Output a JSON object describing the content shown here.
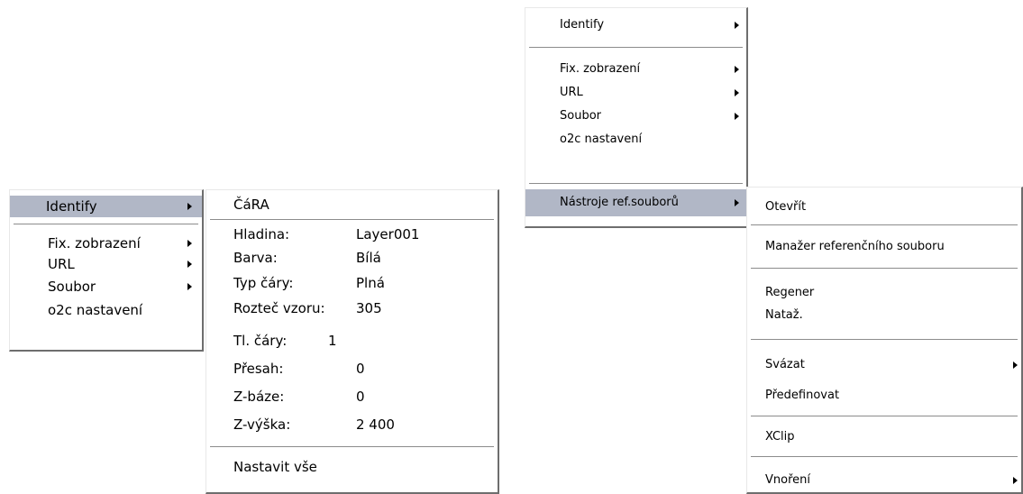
{
  "left_menu": {
    "items": [
      {
        "label": "Identify",
        "has_submenu": true,
        "selected": true
      },
      {
        "label": "Fix. zobrazení",
        "has_submenu": true
      },
      {
        "label": "URL",
        "has_submenu": true
      },
      {
        "label": "Soubor",
        "has_submenu": true
      },
      {
        "label": "o2c nastavení",
        "has_submenu": false
      }
    ]
  },
  "identify_panel": {
    "title": "ČáRA",
    "properties": [
      {
        "key": "Hladina:",
        "value": "Layer001"
      },
      {
        "key": "Barva:",
        "value": "Bílá"
      },
      {
        "key": "Typ čáry:",
        "value": "Plná"
      },
      {
        "key": "Rozteč vzoru:",
        "value": "305"
      },
      {
        "key": "Tl. čáry:",
        "value": "1"
      },
      {
        "key": "Přesah:",
        "value": "0"
      },
      {
        "key": "Z-báze:",
        "value": "0"
      },
      {
        "key": "Z-výška:",
        "value": "2 400"
      }
    ],
    "set_all": "Nastavit vše"
  },
  "right_menu": {
    "items": [
      {
        "label": "Identify",
        "has_submenu": true
      },
      {
        "label": "Fix. zobrazení",
        "has_submenu": true
      },
      {
        "label": "URL",
        "has_submenu": true
      },
      {
        "label": "Soubor",
        "has_submenu": true
      },
      {
        "label": "o2c nastavení",
        "has_submenu": false
      },
      {
        "label": "Nástroje ref.souborů",
        "has_submenu": true,
        "selected": true
      }
    ]
  },
  "ref_tools_submenu": {
    "items": [
      {
        "label": "Otevřít"
      },
      {
        "label": "Manažer referenčního souboru"
      },
      {
        "label": "Regener"
      },
      {
        "label": "Nataž."
      },
      {
        "label": "Svázat",
        "has_submenu": true
      },
      {
        "label": "Předefinovat"
      },
      {
        "label": "XClip"
      },
      {
        "label": "Vnoření",
        "has_submenu": true
      }
    ]
  },
  "colors": {
    "selection": "#b1b7c6",
    "menu_bg": "#ffffff",
    "separator": "#8c8c8c"
  }
}
